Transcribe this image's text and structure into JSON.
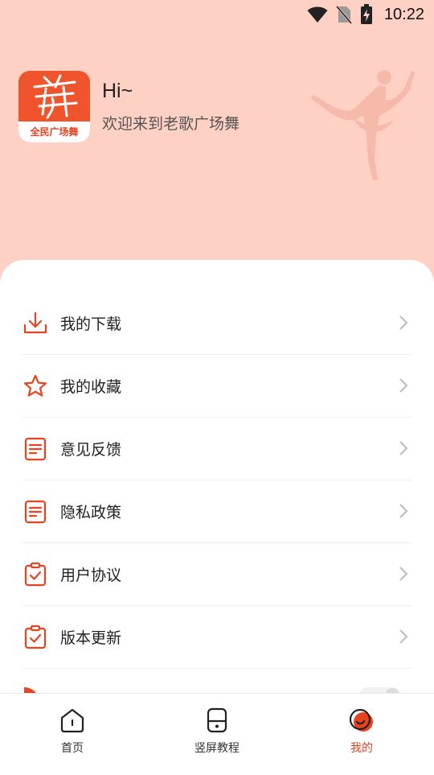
{
  "status_bar": {
    "time": "10:22",
    "icons": [
      "wifi-icon",
      "no-sim-icon",
      "battery-charging-icon"
    ]
  },
  "profile": {
    "avatar_text": "全民广场舞",
    "avatar_glyph": "舞",
    "greeting": "Hi~",
    "welcome": "欢迎来到老歌广场舞"
  },
  "colors": {
    "accent": "#e8421e",
    "header_bg": "#ffd1c5",
    "divider": "#eeeeee"
  },
  "menu": {
    "items": [
      {
        "label": "我的下载",
        "icon": "download-icon"
      },
      {
        "label": "我的收藏",
        "icon": "star-icon"
      },
      {
        "label": "意见反馈",
        "icon": "document-icon"
      },
      {
        "label": "隐私政策",
        "icon": "document-icon"
      },
      {
        "label": "用户协议",
        "icon": "clipboard-check-icon"
      },
      {
        "label": "版本更新",
        "icon": "clipboard-check-icon"
      }
    ]
  },
  "tabbar": {
    "tabs": [
      {
        "label": "首页",
        "icon": "home-icon",
        "active": false
      },
      {
        "label": "竖屏教程",
        "icon": "phone-icon",
        "active": false
      },
      {
        "label": "我的",
        "icon": "profile-icon",
        "active": true
      }
    ]
  }
}
